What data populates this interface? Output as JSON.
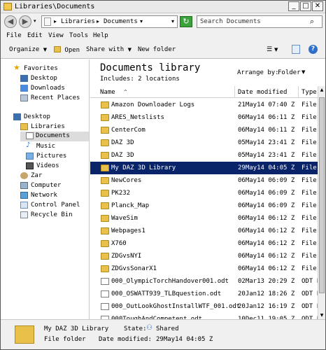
{
  "window": {
    "title": "Libraries\\Documents"
  },
  "address": {
    "parts": [
      "Libraries",
      "Documents"
    ],
    "search_placeholder": "Search Documents"
  },
  "menu": [
    "File",
    "Edit",
    "View",
    "Tools",
    "Help"
  ],
  "commands": {
    "organize": "Organize",
    "open": "Open",
    "share": "Share with",
    "newfolder": "New folder"
  },
  "nav": {
    "favorites": "Favorites",
    "desktop_fav": "Desktop",
    "downloads": "Downloads",
    "recent": "Recent Places",
    "desktop": "Desktop",
    "libraries": "Libraries",
    "documents": "Documents",
    "music": "Music",
    "pictures": "Pictures",
    "videos": "Videos",
    "zar": "Zar",
    "computer": "Computer",
    "network": "Network",
    "control_panel": "Control Panel",
    "recycle_bin": "Recycle Bin"
  },
  "library": {
    "title": "Documents library",
    "includes": "Includes: 2 locations",
    "arrange_by_label": "Arrange by:",
    "arrange_by_value": "Folder"
  },
  "columns": {
    "name": "Name",
    "date": "Date modified",
    "type": "Type"
  },
  "files": [
    {
      "name": "Amazon Downloader Logs",
      "date": "21May14 07:40 Z",
      "type": "File",
      "kind": "folder"
    },
    {
      "name": "ARES_Netslists",
      "date": "06May14 06:11 Z",
      "type": "File",
      "kind": "folder"
    },
    {
      "name": "CenterCom",
      "date": "06May14 06:11 Z",
      "type": "File",
      "kind": "folder"
    },
    {
      "name": "DAZ 3D",
      "date": "05May14 23:41 Z",
      "type": "File",
      "kind": "folder"
    },
    {
      "name": "DAZ 3D",
      "date": "05May14 23:41 Z",
      "type": "File",
      "kind": "folder"
    },
    {
      "name": "My DAZ 3D Library",
      "date": "29May14 04:05 Z",
      "type": "File",
      "kind": "folder",
      "selected": true
    },
    {
      "name": "NewCores",
      "date": "06May14 06:09 Z",
      "type": "File",
      "kind": "folder"
    },
    {
      "name": "PK232",
      "date": "06May14 06:09 Z",
      "type": "File",
      "kind": "folder"
    },
    {
      "name": "Planck_Map",
      "date": "06May14 06:09 Z",
      "type": "File",
      "kind": "folder"
    },
    {
      "name": "WaveSim",
      "date": "06May14 06:12 Z",
      "type": "File",
      "kind": "folder"
    },
    {
      "name": "Webpages1",
      "date": "06May14 06:12 Z",
      "type": "File",
      "kind": "folder"
    },
    {
      "name": "X760",
      "date": "06May14 06:12 Z",
      "type": "File",
      "kind": "folder"
    },
    {
      "name": "ZDGvsNYI",
      "date": "06May14 06:12 Z",
      "type": "File",
      "kind": "folder"
    },
    {
      "name": "ZDGvsSonarX1",
      "date": "06May14 06:12 Z",
      "type": "File",
      "kind": "folder"
    },
    {
      "name": "000_OlympicTorchHandover001.odt",
      "date": "02Mar13 20:29 Z",
      "type": "ODT F",
      "kind": "doc"
    },
    {
      "name": "000_OSWATT939_TLBquestion.odt",
      "date": "20Jan12 18:26 Z",
      "type": "ODT F",
      "kind": "doc"
    },
    {
      "name": "000_OutLookGhostInstallWTF_001.odt",
      "date": "20Jan12 16:19 Z",
      "type": "ODT F",
      "kind": "doc"
    },
    {
      "name": "000ToughAndCompetent.odt",
      "date": "10Dec11 19:05 Z",
      "type": "ODT F",
      "kind": "doc"
    }
  ],
  "details": {
    "name": "My DAZ 3D Library",
    "kind": "File folder",
    "state_label": "State:",
    "state_value": "Shared",
    "date_label": "Date modified:",
    "date_value": "29May14 04:05 Z"
  }
}
